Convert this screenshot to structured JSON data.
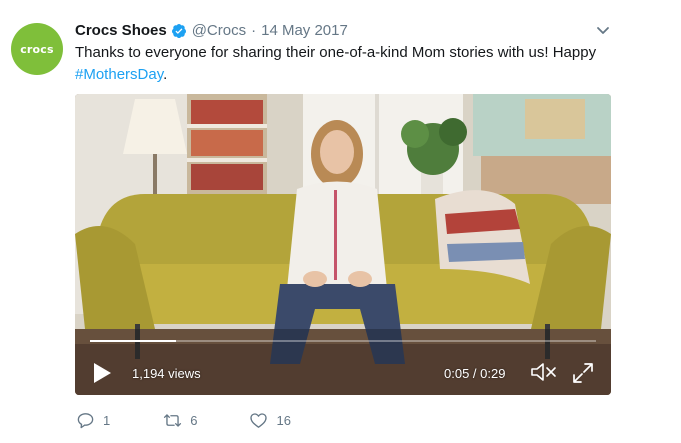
{
  "tweet": {
    "avatar_text": "crocs",
    "name": "Crocs Shoes",
    "handle": "@Crocs",
    "separator": "·",
    "date": "14 May 2017",
    "text": "Thanks to everyone for sharing their one-of-a-kind Mom stories with us! Happy",
    "hashtag": "#MothersDay",
    "text_end": "."
  },
  "video": {
    "views": "1,194 views",
    "time": "0:05 / 0:29",
    "progress": 0.17
  },
  "actions": {
    "replies": "1",
    "retweets": "6",
    "likes": "16"
  },
  "colors": {
    "brand_avatar": "#7fbf3a",
    "link": "#1da1f2",
    "muted": "#657786"
  }
}
